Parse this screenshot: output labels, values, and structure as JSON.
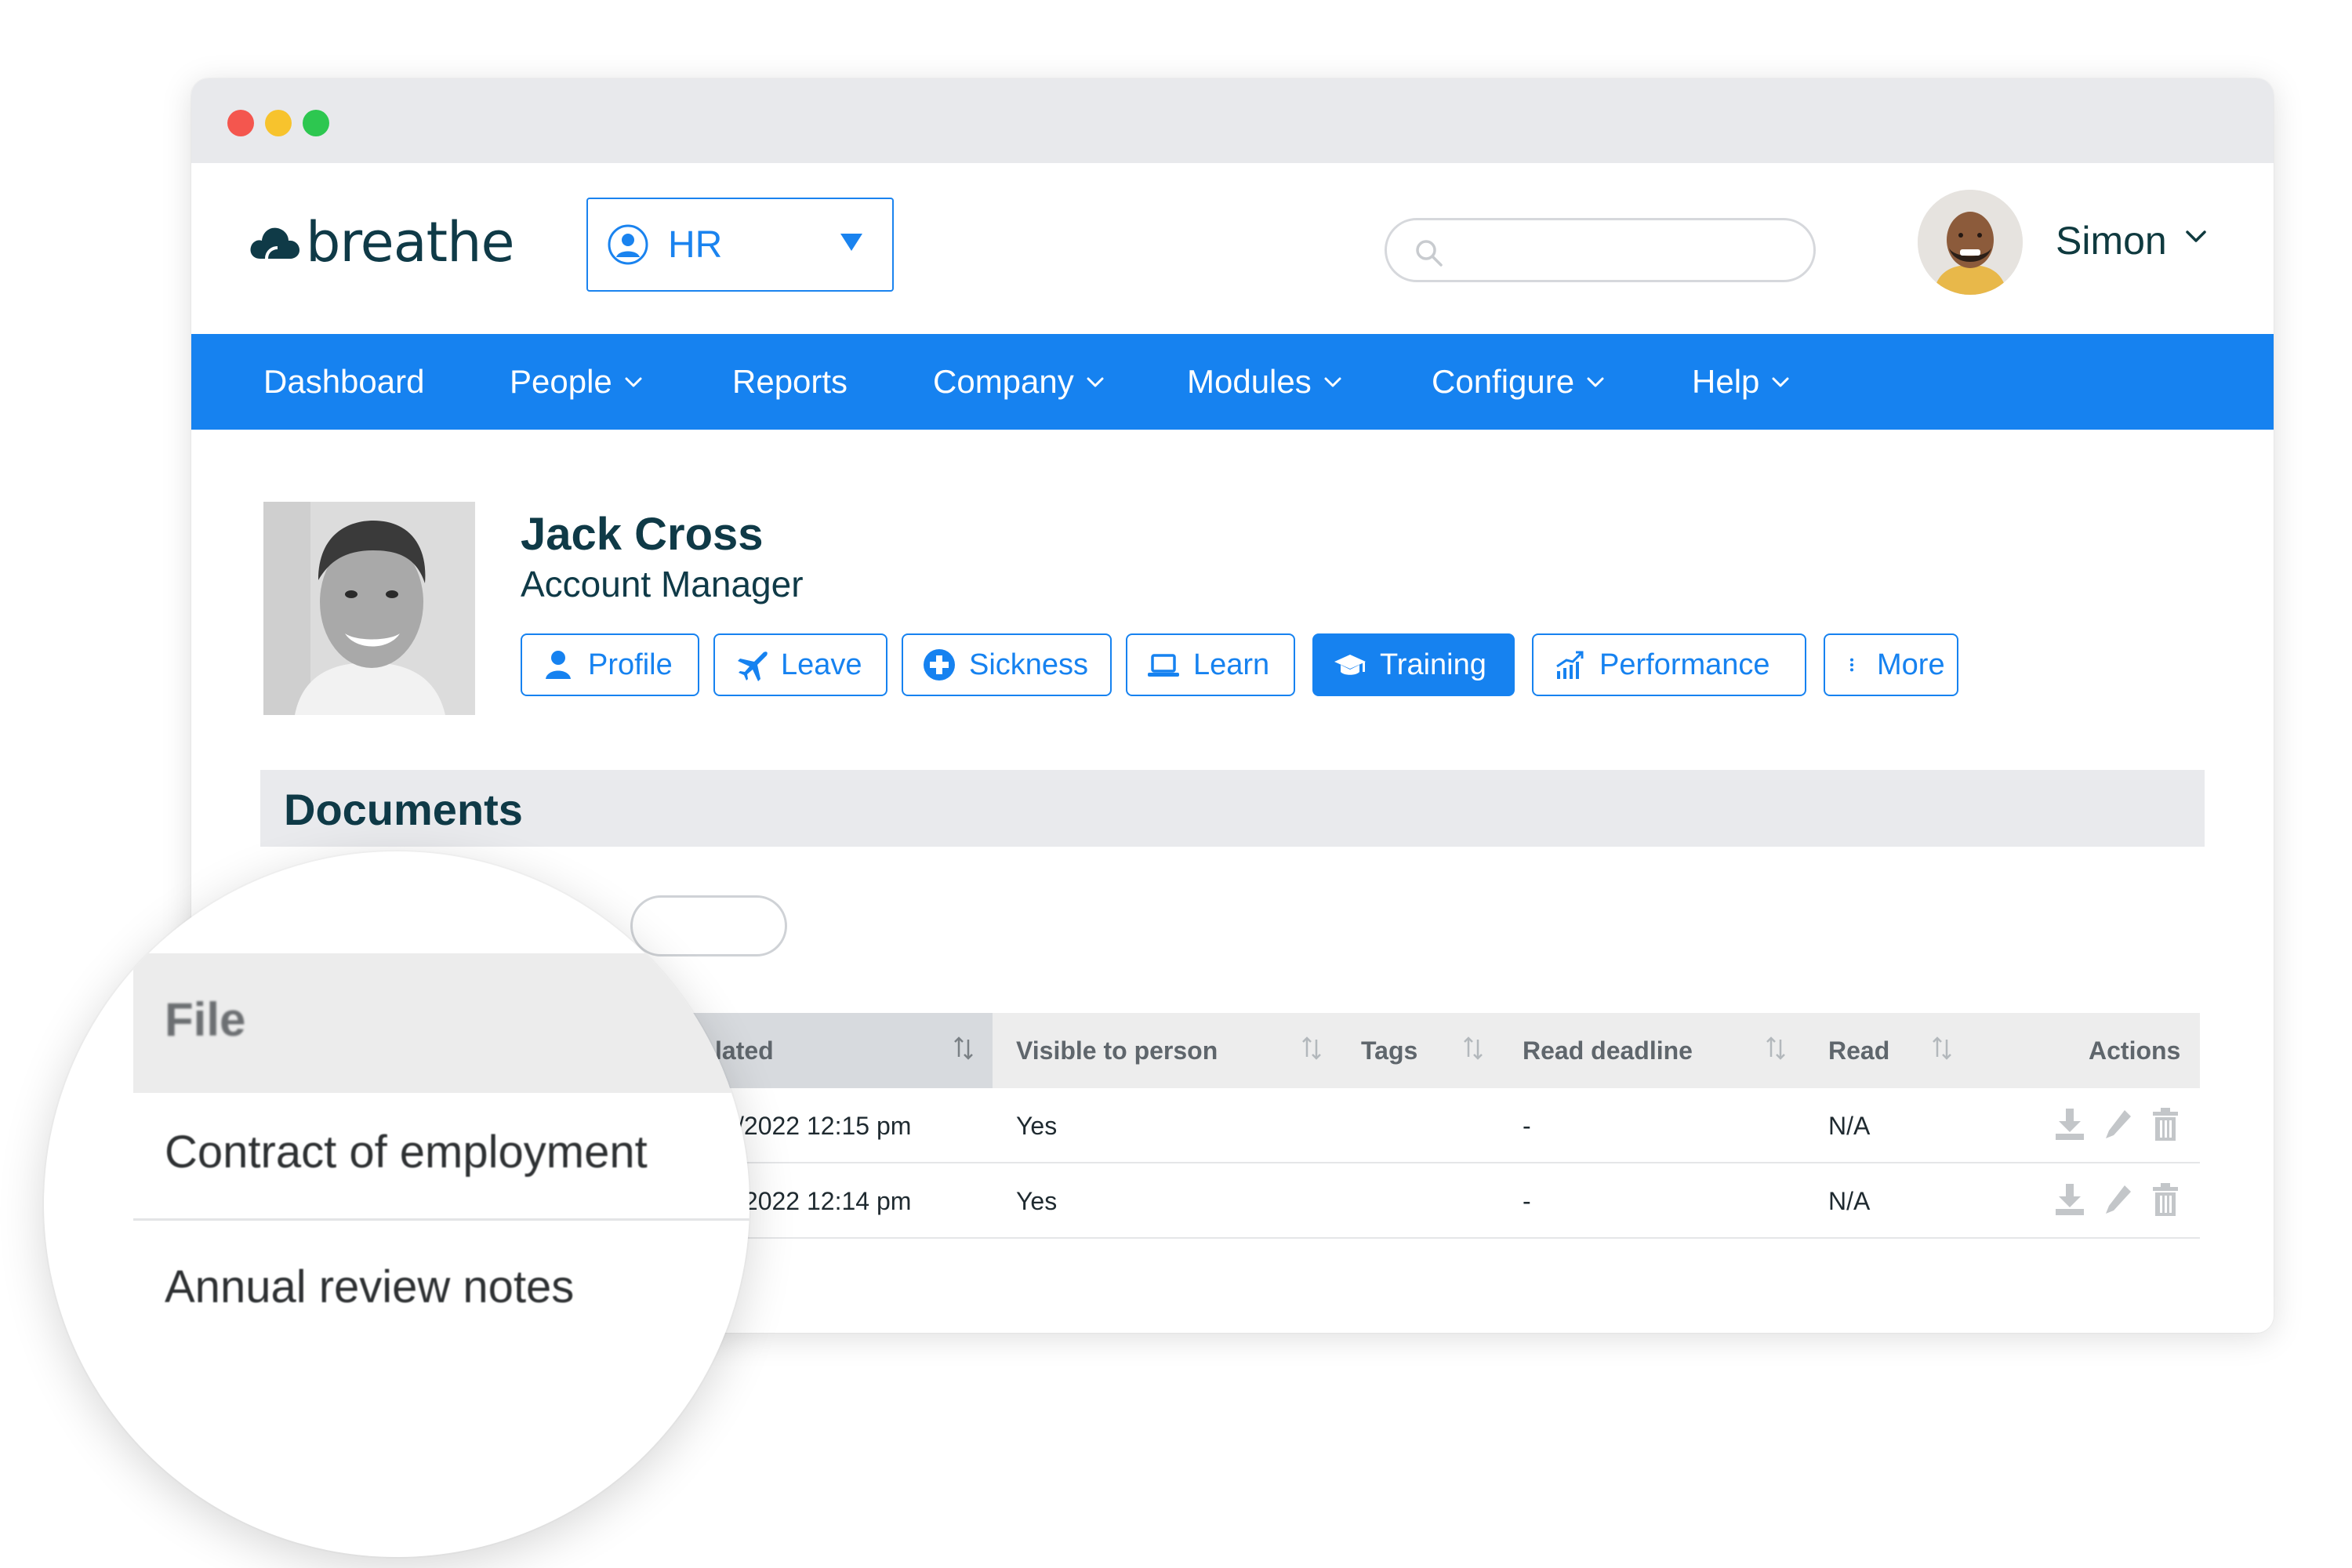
{
  "app": {
    "logo_text": "breathe"
  },
  "module_select": {
    "value": "HR"
  },
  "search": {
    "placeholder": ""
  },
  "user": {
    "name": "Simon"
  },
  "nav": {
    "items": [
      {
        "label": "Dashboard",
        "dropdown": false
      },
      {
        "label": "People",
        "dropdown": true
      },
      {
        "label": "Reports",
        "dropdown": false
      },
      {
        "label": "Company",
        "dropdown": true
      },
      {
        "label": "Modules",
        "dropdown": true
      },
      {
        "label": "Configure",
        "dropdown": true
      },
      {
        "label": "Help",
        "dropdown": true
      }
    ]
  },
  "person": {
    "name": "Jack Cross",
    "role": "Account Manager"
  },
  "tabs": [
    {
      "label": "Profile",
      "icon": "person-icon",
      "active": false
    },
    {
      "label": "Leave",
      "icon": "plane-icon",
      "active": false
    },
    {
      "label": "Sickness",
      "icon": "medical-cross-icon",
      "active": false
    },
    {
      "label": "Learn",
      "icon": "laptop-icon",
      "active": false
    },
    {
      "label": "Training",
      "icon": "graduation-cap-icon",
      "active": true
    },
    {
      "label": "Performance",
      "icon": "chart-growth-icon",
      "active": false
    },
    {
      "label": "More",
      "icon": "vertical-dots-icon",
      "active": false
    }
  ],
  "section": {
    "title": "Documents"
  },
  "table": {
    "headers": {
      "file": "File",
      "updated": "lated",
      "visible": "Visible to person",
      "tags": "Tags",
      "read_deadline": "Read deadline",
      "read": "Read",
      "actions": "Actions"
    },
    "rows": [
      {
        "file": "Contract of employment",
        "updated": "/2022 12:15 pm",
        "visible": "Yes",
        "tags": "",
        "read_deadline": "-",
        "read": "N/A"
      },
      {
        "file": "Annual review notes",
        "updated": "/2022 12:14 pm",
        "visible": "Yes",
        "tags": "",
        "read_deadline": "-",
        "read": "N/A"
      }
    ]
  },
  "colors": {
    "primary": "#1682f0",
    "brand_dark": "#0f3a47",
    "header_grey": "#e9eaed",
    "window_chrome": "#e8e9ec"
  }
}
